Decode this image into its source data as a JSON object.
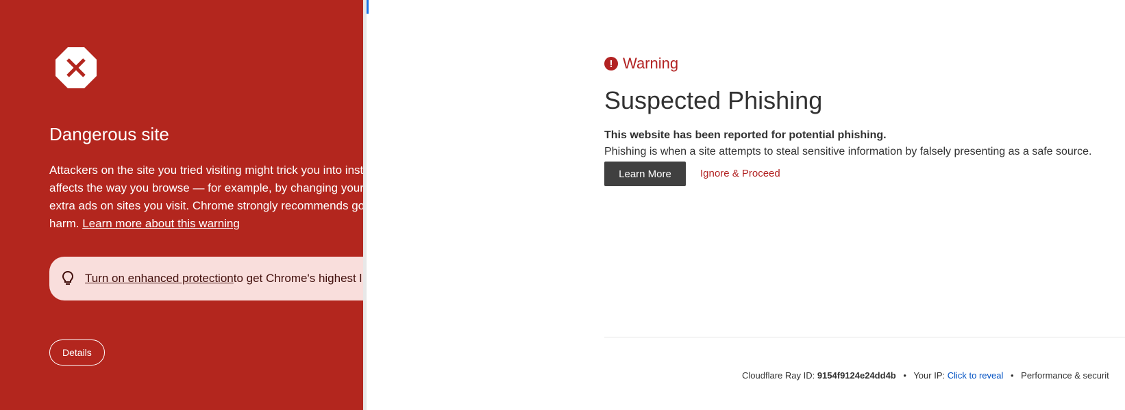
{
  "chrome_warning": {
    "title": "Dangerous site",
    "description_lines": [
      "Attackers on the site you tried visiting might trick you into insta",
      "affects the way you browse — for example, by changing your h",
      "extra ads on sites you visit. Chrome strongly recommends goin",
      "harm."
    ],
    "learn_more_link": "Learn more about this warning",
    "tip_link": "Turn on enhanced protection",
    "tip_text": " to get Chrome's highest l",
    "details_button": "Details",
    "colors": {
      "background": "#b3261e",
      "tip_background": "#f9dedc"
    },
    "icons": {
      "stop": "stop-sign-icon",
      "tip": "lightbulb-icon"
    }
  },
  "cloudflare": {
    "warning_label": "Warning",
    "heading": "Suspected Phishing",
    "reported_text": "This website has been reported for potential phishing.",
    "explanation": "Phishing is when a site attempts to steal sensitive information by falsely presenting as a safe source.",
    "learn_more_button": "Learn More",
    "ignore_link": "Ignore & Proceed",
    "footer": {
      "ray_label": "Cloudflare Ray ID: ",
      "ray_id": "9154f9124e24dd4b",
      "separator": "•",
      "ip_label": "Your IP: ",
      "ip_link": "Click to reveal",
      "performance": "Performance & securit"
    },
    "colors": {
      "accent": "#b22222",
      "button": "#404040",
      "link": "#0051c3"
    },
    "icons": {
      "warning": "exclamation-circle-icon"
    }
  }
}
